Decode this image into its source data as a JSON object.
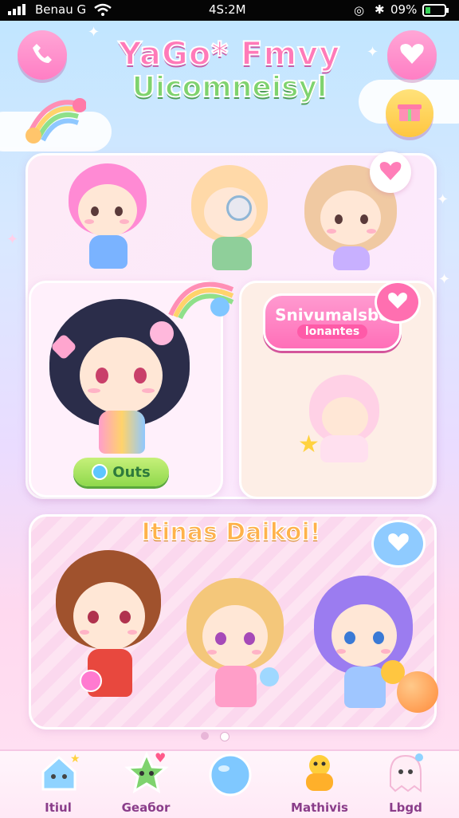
{
  "status_bar": {
    "carrier": "Benau G",
    "time": "4S:2M",
    "battery": "09%"
  },
  "header": {
    "title_line1": "YaGo* Fmvy",
    "title_line2": "Uiсomneisyl",
    "left_button_icon": "phone-icon",
    "right_button_icon": "heart-icon",
    "extra_button_icon": "gift-icon"
  },
  "top_panel": {
    "speech_bubble": {
      "line1": "Snivumalsbe",
      "line2": "lonantes"
    },
    "outs_button": "Outs"
  },
  "bottom_panel": {
    "title": "Itinas Daikoi!"
  },
  "pager": {
    "count": 2,
    "active": 1
  },
  "nav": {
    "items": [
      {
        "label": "Itiul",
        "icon": "home-icon"
      },
      {
        "label": "Geaбor",
        "icon": "star-icon"
      },
      {
        "label": "",
        "icon": "chat-bubble-icon"
      },
      {
        "label": "Mathivis",
        "icon": "duck-icon"
      },
      {
        "label": "Lbgd",
        "icon": "ghost-icon"
      }
    ]
  },
  "colors": {
    "pink": "#ff7ab8",
    "green": "#7fd36e",
    "lavender": "#c9a8ff",
    "panel": "#fde7f4"
  }
}
